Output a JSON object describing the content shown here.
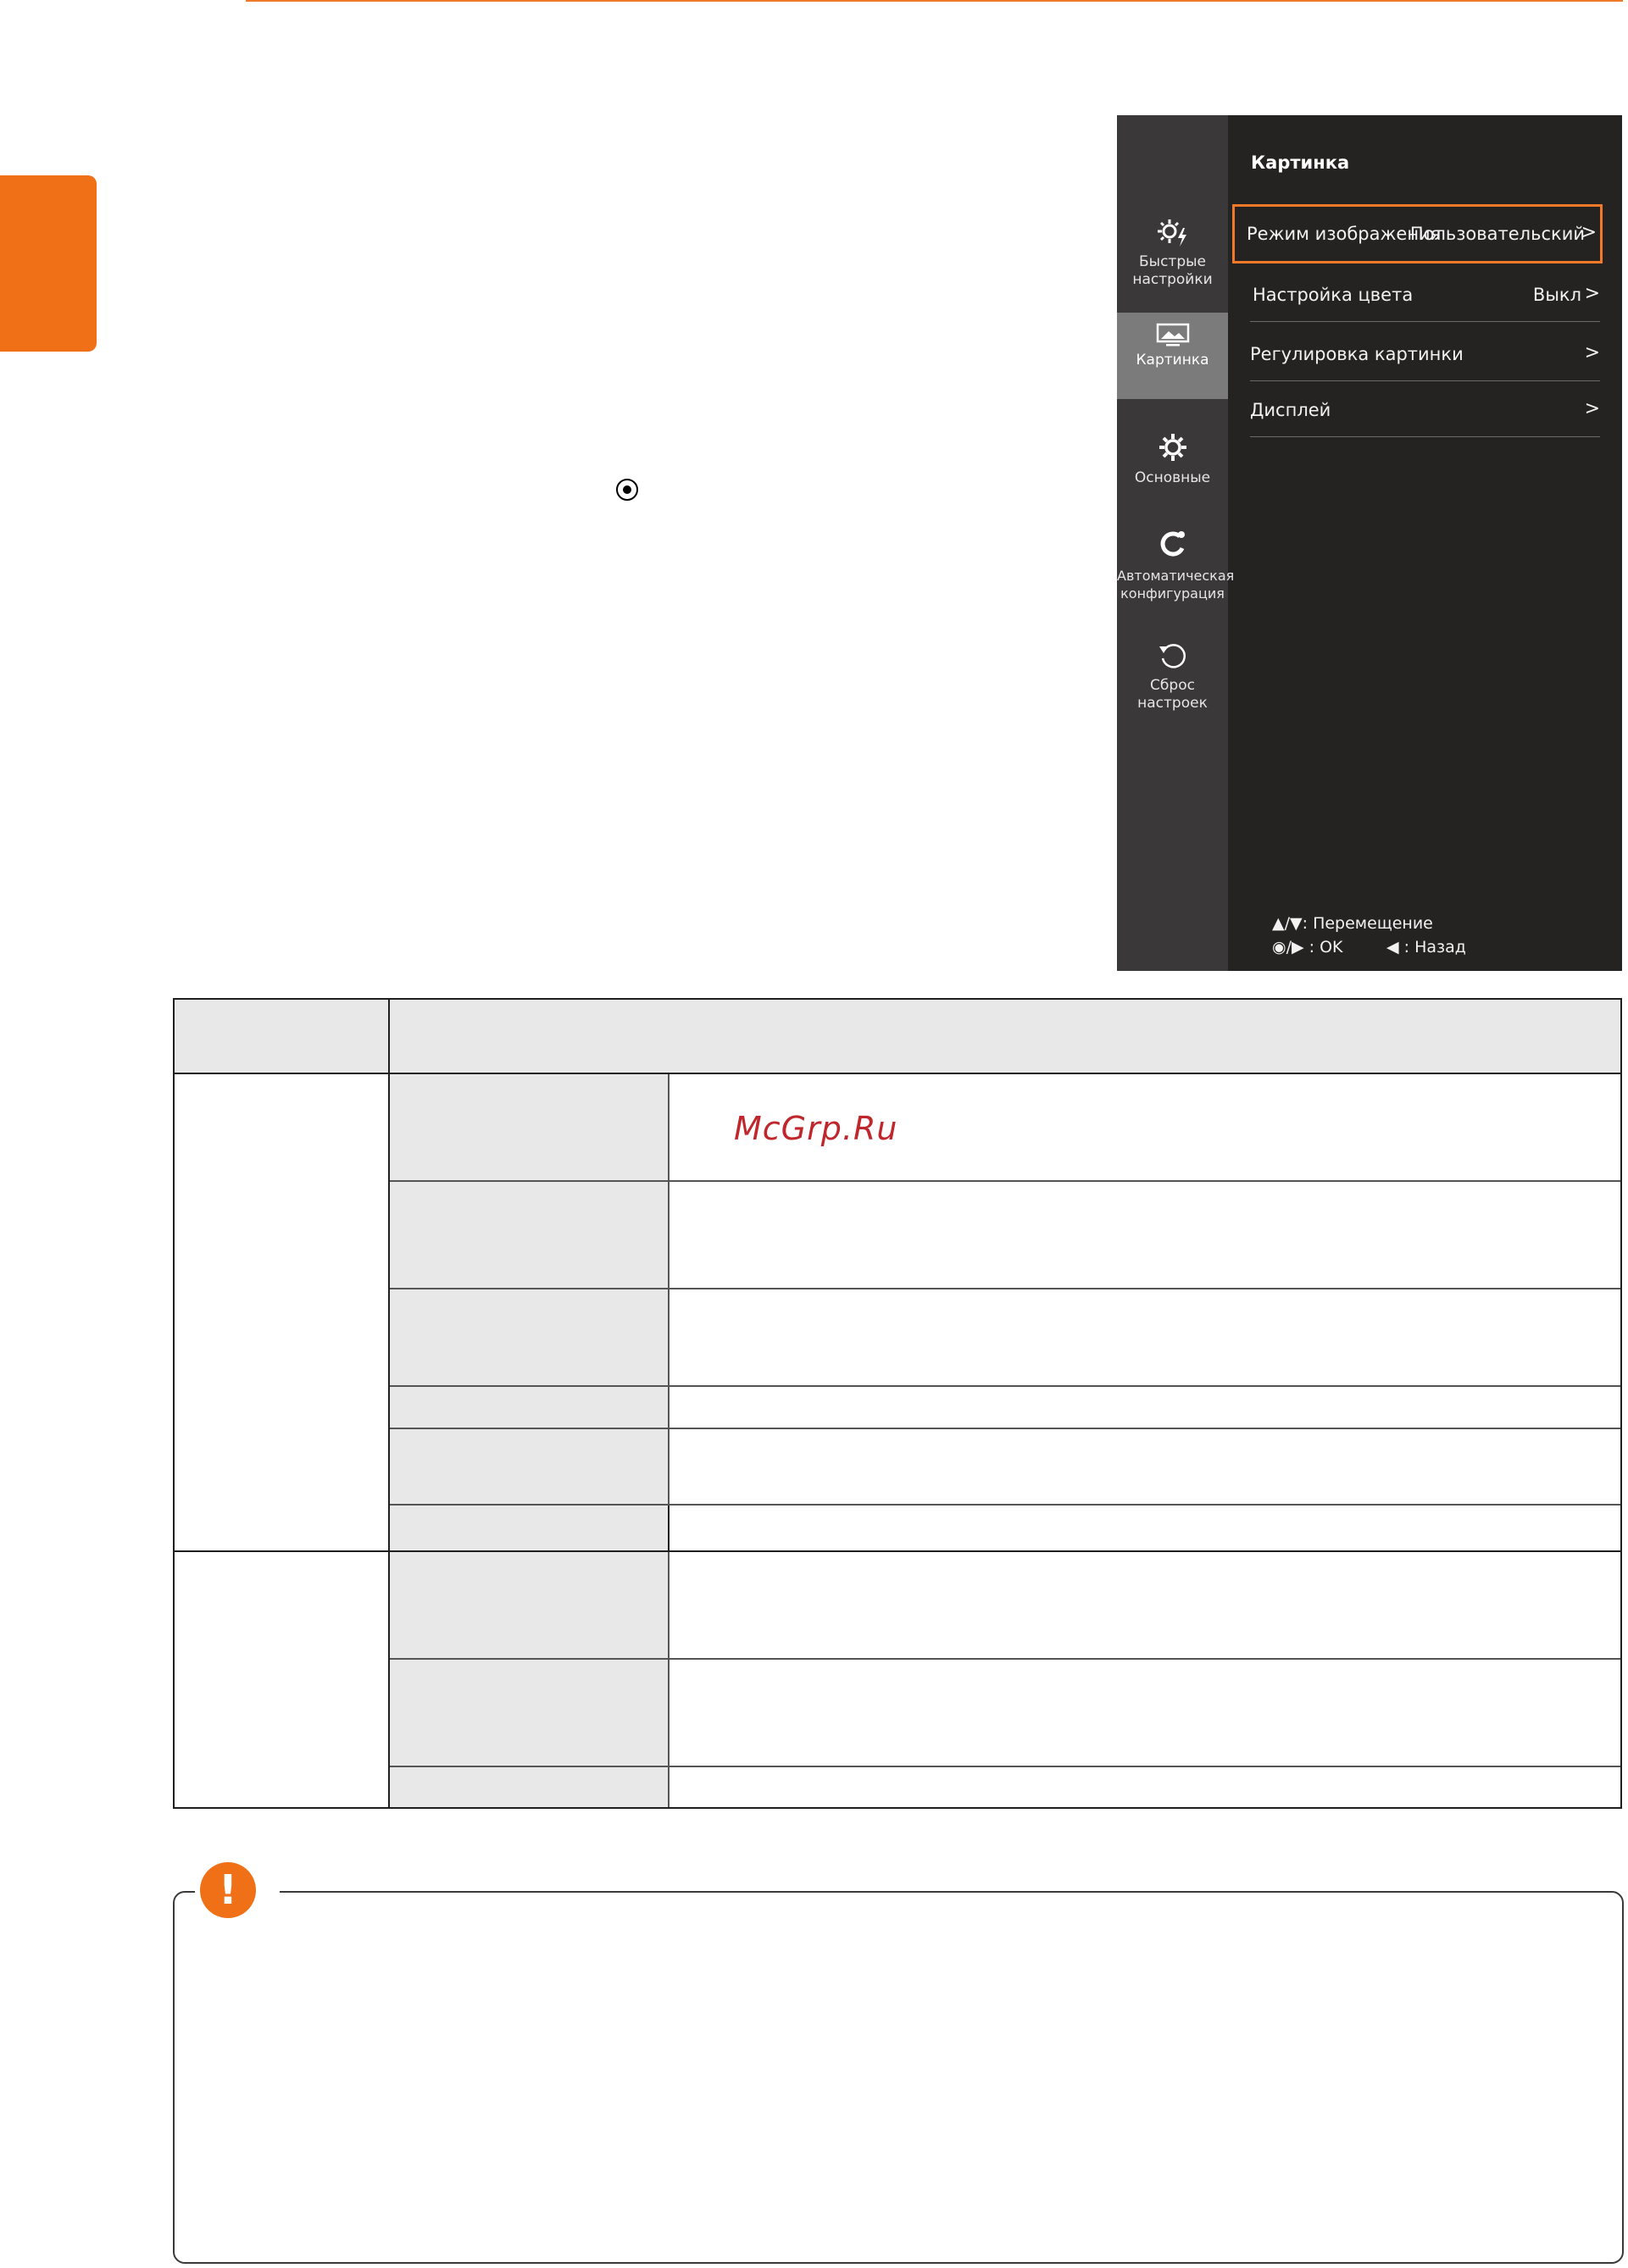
{
  "osd": {
    "sidebar": [
      {
        "icon": "quick-settings-icon",
        "label_line1": "Быстрые",
        "label_line2": "настройки"
      },
      {
        "icon": "picture-icon",
        "label_line1": "Картинка",
        "label_line2": ""
      },
      {
        "icon": "gear-icon",
        "label_line1": "Основные",
        "label_line2": ""
      },
      {
        "icon": "auto-config-icon",
        "label_line1": "Автоматическая",
        "label_line2": "конфигурация"
      },
      {
        "icon": "reset-icon",
        "label_line1": "Сброс",
        "label_line2": "настроек"
      }
    ],
    "title": "Картинка",
    "items": [
      {
        "label": "Режим изображения",
        "value": "Пользовательский",
        "chevron": ">"
      },
      {
        "label": "Настройка цвета",
        "value": "Выкл",
        "chevron": ">"
      },
      {
        "label": "Регулировка картинки",
        "value": "",
        "chevron": ">"
      },
      {
        "label": "Дисплей",
        "value": "",
        "chevron": ">"
      }
    ],
    "hints": {
      "move": "▲/▼: Перемещение",
      "ok": "◉/▶ : OK",
      "back": "◀ : Назад"
    }
  },
  "watermark": "McGrp.Ru",
  "colors": {
    "accent": "#f07018",
    "osd_bg": "#252222",
    "osd_rail": "#3a3838",
    "osd_active": "#7b7b7b"
  }
}
